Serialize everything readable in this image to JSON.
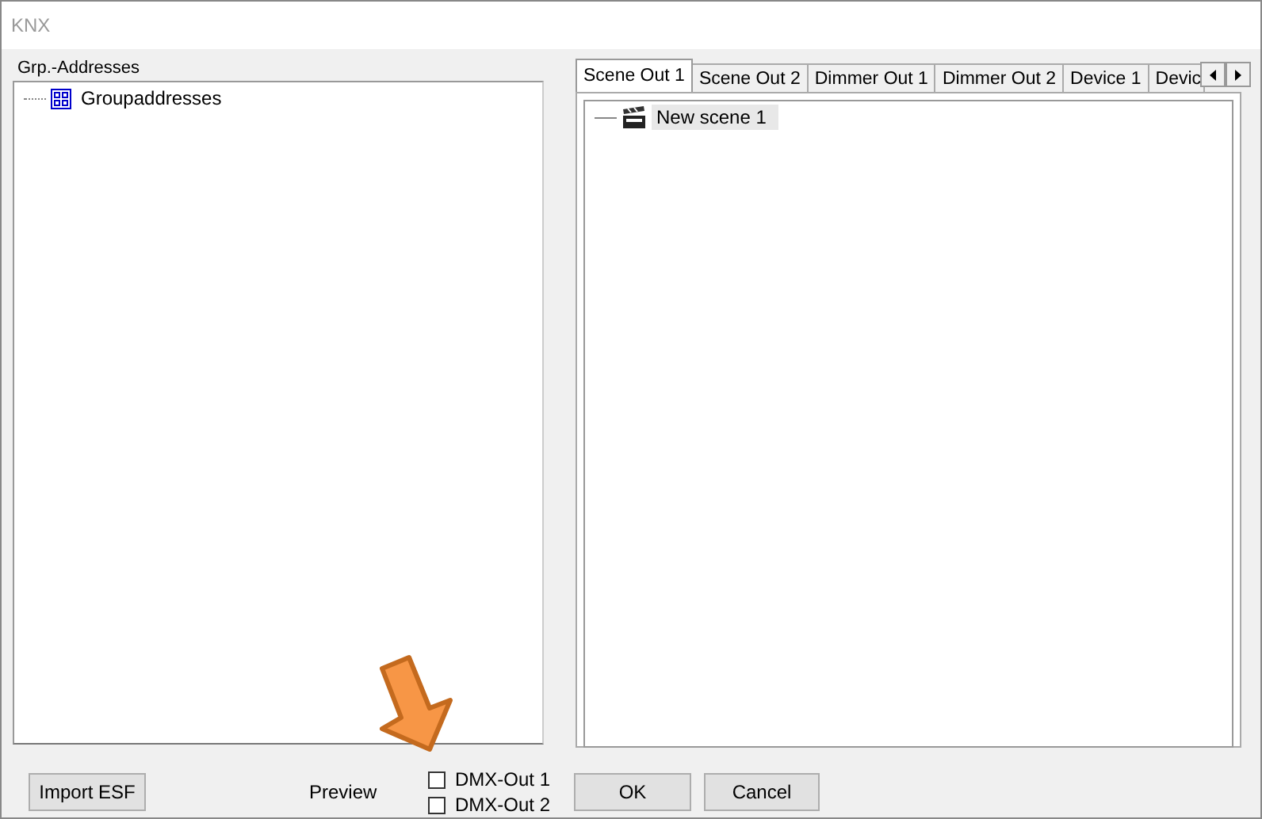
{
  "window": {
    "title": "KNX"
  },
  "left_panel": {
    "label": "Grp.-Addresses",
    "tree": [
      {
        "label": "Groupaddresses",
        "selected": false
      }
    ]
  },
  "tabs": [
    {
      "label": "Scene Out 1",
      "selected": true
    },
    {
      "label": "Scene Out 2",
      "selected": false
    },
    {
      "label": "Dimmer Out 1",
      "selected": false
    },
    {
      "label": "Dimmer Out 2",
      "selected": false
    },
    {
      "label": "Device 1",
      "selected": false
    },
    {
      "label": "Devic",
      "selected": false
    }
  ],
  "scene_tree": [
    {
      "label": "New scene 1",
      "selected": true
    }
  ],
  "buttons": {
    "import": "Import ESF",
    "ok": "OK",
    "cancel": "Cancel"
  },
  "preview": {
    "label": "Preview",
    "options": [
      {
        "label": "DMX-Out 1",
        "checked": false
      },
      {
        "label": "DMX-Out 2",
        "checked": false
      }
    ]
  }
}
